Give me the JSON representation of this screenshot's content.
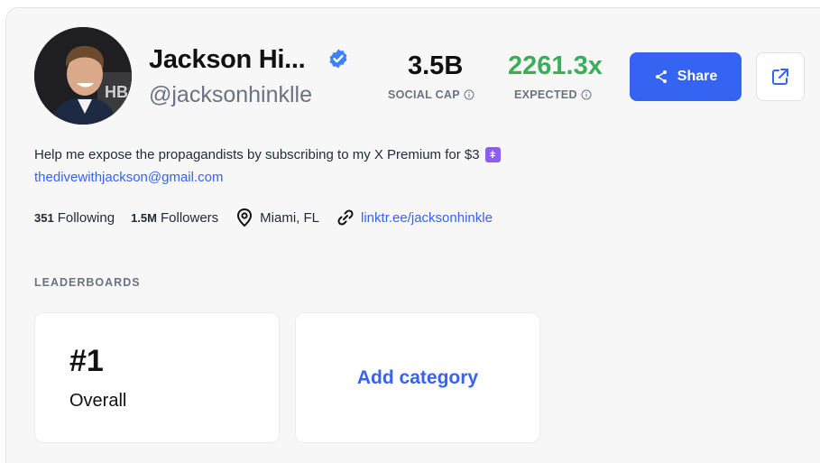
{
  "profile": {
    "name": "Jackson Hi...",
    "handle": "@jacksonhinklle",
    "verified_color": "#3b82f6"
  },
  "stats": {
    "social_cap_value": "3.5B",
    "social_cap_label": "SOCIAL CAP",
    "expected_value": "2261.3x",
    "expected_label": "EXPECTED",
    "expected_color": "#3cae5a"
  },
  "actions": {
    "share_label": "Share",
    "accent": "#3563f2"
  },
  "bio": {
    "text": "Help me expose the propagandists by subscribing to my X Premium for $3",
    "email": "thedivewithjackson@gmail.com"
  },
  "meta": {
    "following_count": "351",
    "following_label": "Following",
    "followers_count": "1.5M",
    "followers_label": "Followers",
    "location": "Miami, FL",
    "link": "linktr.ee/jacksonhinkle"
  },
  "leaderboards": {
    "title": "LEADERBOARDS",
    "items": [
      {
        "rank": "#1",
        "label": "Overall"
      }
    ],
    "add_label": "Add category"
  }
}
